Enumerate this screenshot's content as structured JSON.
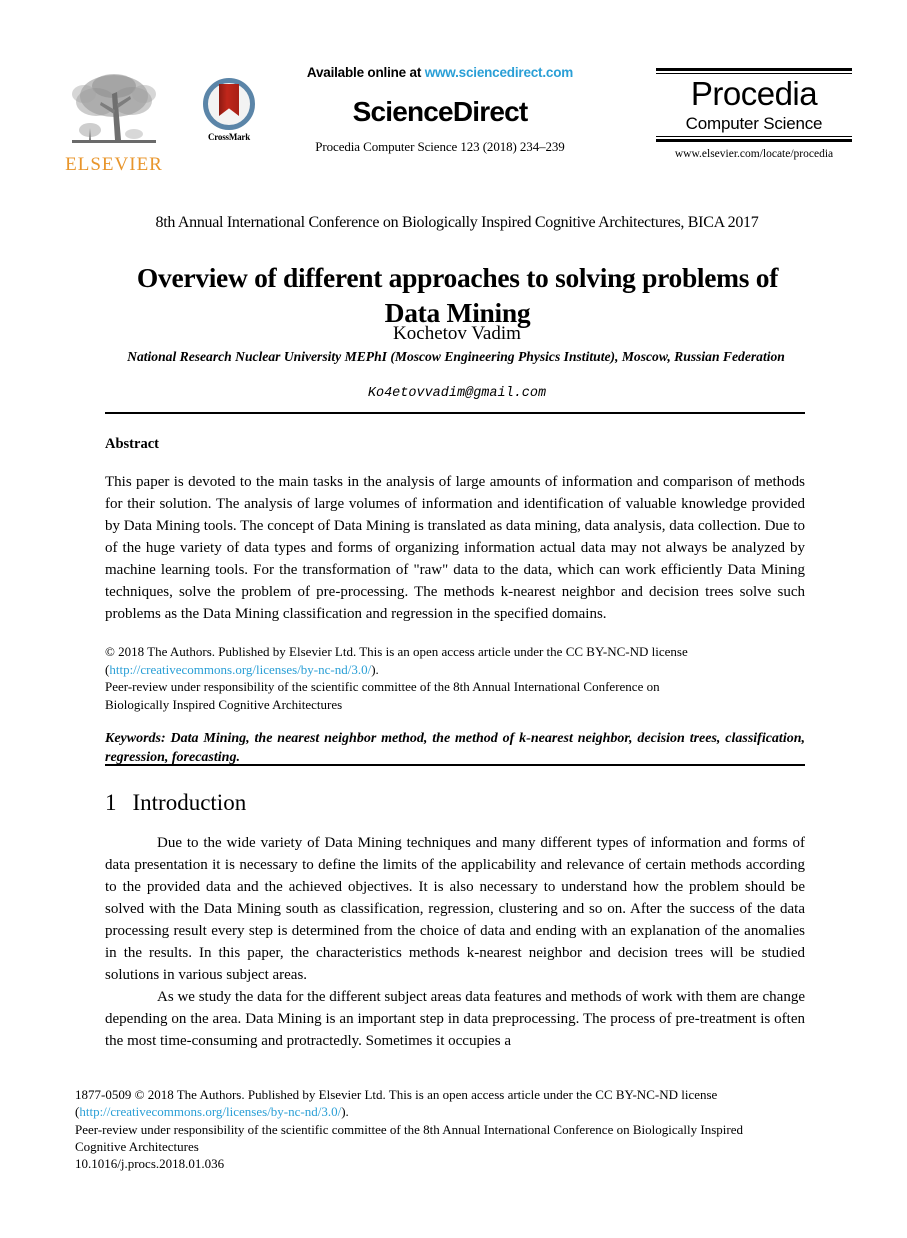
{
  "masthead": {
    "elsevier_wordmark": "ELSEVIER",
    "elsevier_logo_icon": "elsevier-tree-logo",
    "crossmark_label": "CrossMark",
    "crossmark_icon": "crossmark-badge-icon",
    "available_prefix": "Available online at ",
    "available_url": "www.sciencedirect.com",
    "sciencedirect_logo": "ScienceDirect",
    "journal_reference": "Procedia Computer Science 123 (2018) 234–239",
    "procedia_title": "Procedia",
    "procedia_subtitle": "Computer Science",
    "procedia_url": "www.elsevier.com/locate/procedia"
  },
  "article": {
    "conference": "8th Annual International Conference on Biologically Inspired Cognitive Architectures, BICA 2017",
    "title": "Overview of different approaches to solving problems of Data Mining",
    "author": "Kochetov Vadim",
    "affiliation": "National Research Nuclear University MEPhI (Moscow Engineering Physics Institute), Moscow, Russian Federation",
    "email": "Ko4etovvadim@gmail.com"
  },
  "abstract": {
    "heading": "Abstract",
    "body": "This paper is devoted to the main tasks in the analysis of large amounts of information and comparison of methods for their solution. The analysis of large volumes of information and identification of valuable knowledge provided by Data Mining tools. The concept of Data Mining is translated as data mining, data analysis, data collection. Due to of the huge variety of data types and forms of organizing information actual data may not always be analyzed by machine learning tools. For the transformation of \"raw\" data to the data, which can work efficiently Data Mining techniques, solve the problem of pre-processing. The methods k-nearest neighbor and decision trees solve such problems as the Data Mining classification and regression in the specified domains.",
    "license_line_1_pre": "© 2018 The Authors. Published by Elsevier Ltd. This is an open access article under the CC BY-NC-ND license",
    "license_link_open": "(",
    "license_link": "http://creativecommons.org/licenses/by-nc-nd/3.0/",
    "license_link_close": ").",
    "peer_review_line_1": "Peer-review under responsibility of the scientific committee of the 8th Annual International Conference on",
    "peer_review_line_2": "Biologically Inspired Cognitive Architectures",
    "keywords": "Keywords: Data Mining, the nearest neighbor method, the method of k-nearest neighbor, decision trees, classification, regression, forecasting."
  },
  "section": {
    "number": "1",
    "heading": "Introduction",
    "paragraph_1": "Due to the wide variety of Data Mining techniques and many different types of information and forms of data presentation it is necessary to define the limits of the applicability and relevance of certain methods according to the provided data and the achieved objectives. It is also necessary to understand how the problem should be solved with the Data Mining south as classification, regression, clustering and so on. After the success of the data processing result every step is determined from the choice of data and ending with an explanation of the anomalies in the results. In this paper, the characteristics methods k-nearest neighbor and decision trees will be studied solutions in various subject areas.",
    "paragraph_2": "As we study the data for the different subject areas data features and methods of work with them are change depending on the area. Data Mining is an important step in data preprocessing. The process of pre-treatment is often the most time-consuming and protractedly. Sometimes it occupies a"
  },
  "footer": {
    "issn_line_pre": "1877-0509 © 2018 The Authors. Published by Elsevier Ltd. This is an open access article under the CC BY-NC-ND license",
    "license_link_open": "(",
    "license_link": "http://creativecommons.org/licenses/by-nc-nd/3.0/",
    "license_link_close": ").",
    "peer_review_line_1": "Peer-review under responsibility of the scientific committee of the 8th Annual International Conference on Biologically Inspired",
    "peer_review_line_2": "Cognitive Architectures",
    "doi": "10.1016/j.procs.2018.01.036"
  },
  "colors": {
    "elsevier_orange": "#E8952B",
    "link_blue": "#2a9fd6",
    "crossmark_red": "#c0271b",
    "crossmark_ring": "#5b85a8"
  }
}
